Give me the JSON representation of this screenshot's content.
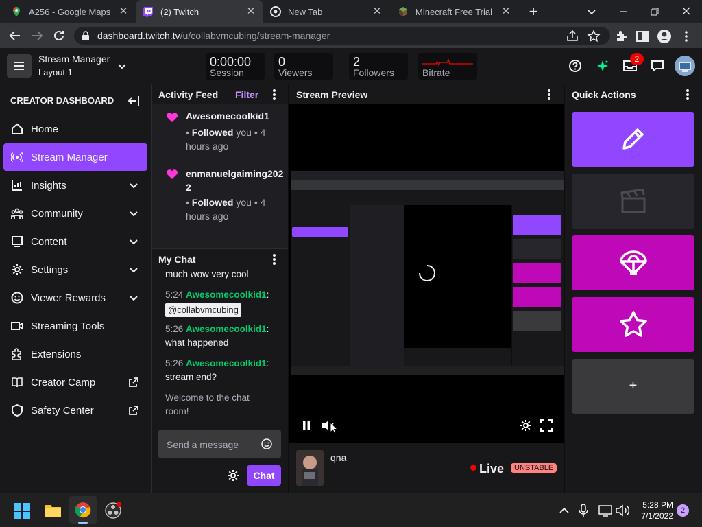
{
  "browser": {
    "tabs": [
      {
        "title": "A256 - Google Maps",
        "active": false
      },
      {
        "title": "(2) Twitch",
        "active": true
      },
      {
        "title": "New Tab",
        "active": false
      },
      {
        "title": "Minecraft Free Trial | M",
        "active": false
      }
    ],
    "url_main": "dashboard.twitch.tv",
    "url_path": "/u/collabvmcubing/stream-manager"
  },
  "header": {
    "title": "Stream Manager",
    "layout": "Layout 1",
    "stats": [
      {
        "value": "0:00:00",
        "label": "Session"
      },
      {
        "value": "0",
        "label": "Viewers"
      },
      {
        "value": "2",
        "label": "Followers"
      },
      {
        "value": "",
        "label": "Bitrate"
      }
    ],
    "notification_count": "2"
  },
  "sidebar": {
    "heading": "CREATOR DASHBOARD",
    "items": [
      {
        "label": "Home",
        "icon": "home-icon"
      },
      {
        "label": "Stream Manager",
        "icon": "broadcast-icon"
      },
      {
        "label": "Insights",
        "icon": "chart-icon"
      },
      {
        "label": "Community",
        "icon": "people-icon"
      },
      {
        "label": "Content",
        "icon": "content-icon"
      },
      {
        "label": "Settings",
        "icon": "gear-icon"
      },
      {
        "label": "Viewer Rewards",
        "icon": "smile-icon"
      },
      {
        "label": "Streaming Tools",
        "icon": "camera-icon"
      },
      {
        "label": "Extensions",
        "icon": "puzzle-icon"
      },
      {
        "label": "Creator Camp",
        "icon": "book-icon"
      },
      {
        "label": "Safety Center",
        "icon": "shield-icon"
      }
    ]
  },
  "activity": {
    "title": "Activity Feed",
    "filter": "Filter",
    "events": [
      {
        "name": "Awesomecoolkid1",
        "action": "Followed",
        "rest": " you",
        "time": "4 hours ago"
      },
      {
        "name_line1": "enmanuelgaiming202",
        "name_line2": "2",
        "action": "Followed",
        "rest": " you",
        "time": "4 hours ago"
      }
    ]
  },
  "chat": {
    "title": "My Chat",
    "messages": [
      {
        "text": "much wow very cool"
      },
      {
        "time": "5:24",
        "user": "Awesomecoolkid1",
        "mention": "@collabvmcubing"
      },
      {
        "time": "5:26",
        "user": "Awesomecoolkid1",
        "text": "what happened"
      },
      {
        "time": "5:26",
        "user": "Awesomecoolkid1",
        "text": "stream end?"
      }
    ],
    "welcome": "Welcome to the chat room!",
    "placeholder": "Send a message",
    "send_label": "Chat"
  },
  "preview": {
    "title": "Stream Preview",
    "stream_title": "qna",
    "live_label": "Live",
    "badge": "UNSTABLE"
  },
  "quick_actions": {
    "title": "Quick Actions",
    "add_label": "+",
    "colors": {
      "edit": "#9147ff",
      "disabled": "#26262c",
      "pink": "#bf09b8",
      "add": "#3a3a3d"
    }
  },
  "taskbar": {
    "time": "5:28 PM",
    "date": "7/1/2022",
    "badge": "2"
  }
}
